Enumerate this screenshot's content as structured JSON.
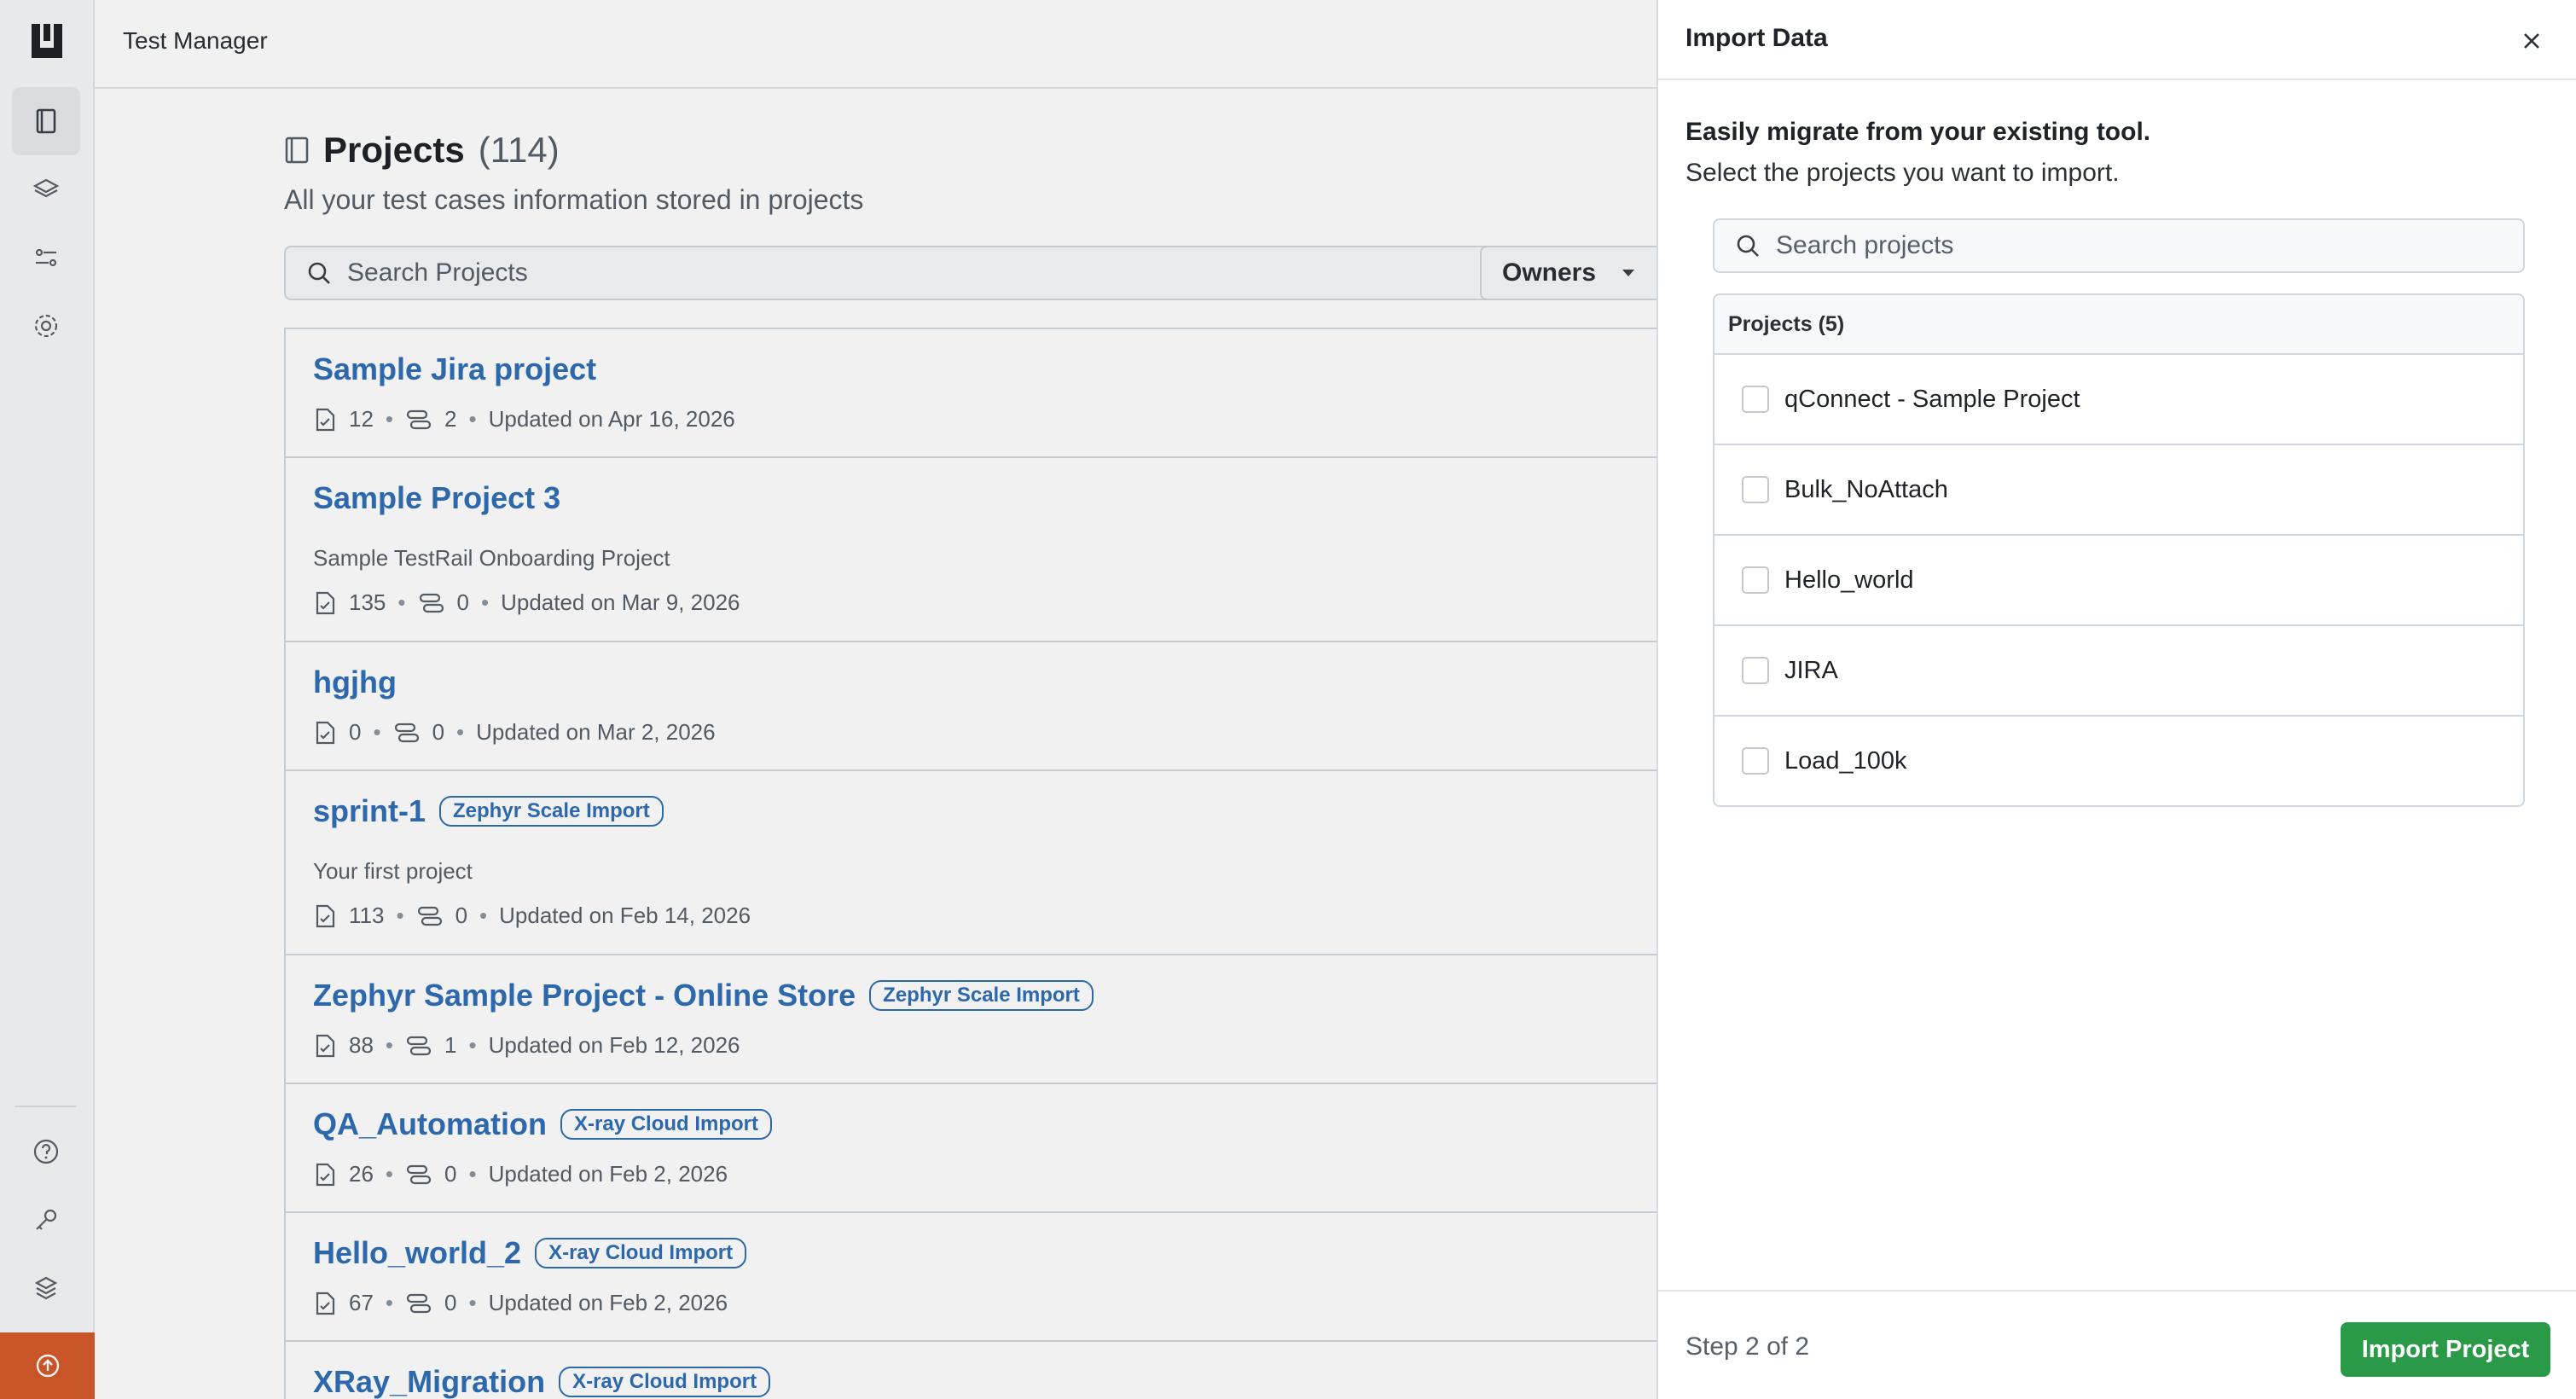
{
  "app": {
    "title": "Test Manager"
  },
  "rail": {
    "items": [
      "projects-icon",
      "layers-icon",
      "workflow-icon",
      "settings-icon"
    ],
    "bottom": [
      "help-icon",
      "key-icon",
      "stack-icon",
      "upgrade-icon"
    ]
  },
  "main": {
    "title": "Projects",
    "count": "(114)",
    "subtitle": "All your test cases information stored in projects",
    "search_placeholder": "Search Projects",
    "owners_label": "Owners",
    "projects": [
      {
        "name": "Sample Jira project",
        "badge": "",
        "desc": "",
        "cases": "12",
        "cycles": "2",
        "updated": "Updated on Apr 16, 2026"
      },
      {
        "name": "Sample Project 3",
        "badge": "",
        "desc": "Sample TestRail Onboarding Project",
        "cases": "135",
        "cycles": "0",
        "updated": "Updated on Mar 9, 2026"
      },
      {
        "name": "hgjhg",
        "badge": "",
        "desc": "",
        "cases": "0",
        "cycles": "0",
        "updated": "Updated on Mar 2, 2026"
      },
      {
        "name": "sprint-1",
        "badge": "Zephyr Scale Import",
        "desc": "Your first project",
        "cases": "113",
        "cycles": "0",
        "updated": "Updated on Feb 14, 2026"
      },
      {
        "name": "Zephyr Sample Project - Online Store",
        "badge": "Zephyr Scale Import",
        "desc": "",
        "cases": "88",
        "cycles": "1",
        "updated": "Updated on Feb 12, 2026"
      },
      {
        "name": "QA_Automation",
        "badge": "X-ray Cloud Import",
        "desc": "",
        "cases": "26",
        "cycles": "0",
        "updated": "Updated on Feb 2, 2026"
      },
      {
        "name": "Hello_world_2",
        "badge": "X-ray Cloud Import",
        "desc": "",
        "cases": "67",
        "cycles": "0",
        "updated": "Updated on Feb 2, 2026"
      },
      {
        "name": "XRay_Migration",
        "badge": "X-ray Cloud Import",
        "desc": "",
        "cases": "",
        "cycles": "",
        "updated": ""
      }
    ]
  },
  "drawer": {
    "title": "Import Data",
    "lead": "Easily migrate from your existing tool.",
    "sub": "Select the projects you want to import.",
    "search_placeholder": "Search projects",
    "list_header": "Projects (5)",
    "items": [
      "qConnect - Sample Project",
      "Bulk_NoAttach",
      "Hello_world",
      "JIRA",
      "Load_100k"
    ],
    "step": "Step 2 of 2",
    "import_button": "Import Project"
  },
  "colors": {
    "accent": "#2f6fb5",
    "primary_button": "#2a9a48",
    "rail_orange": "#d35a2b"
  }
}
